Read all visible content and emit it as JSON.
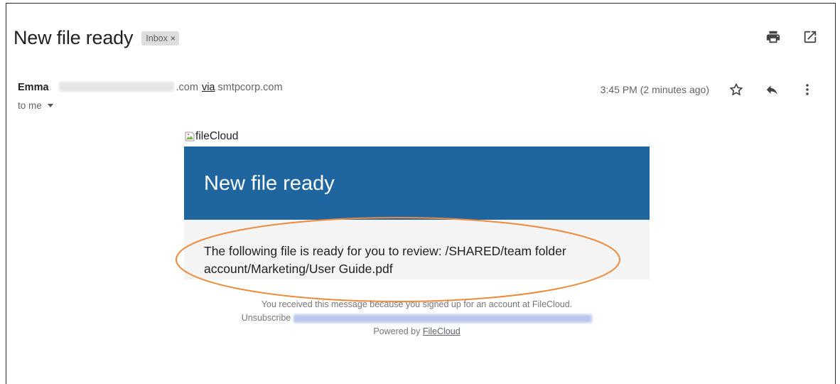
{
  "email": {
    "subject": "New file ready",
    "label": "Inbox",
    "label_remove": "×",
    "sender_name": "Emma",
    "sender_domain": ".com",
    "via_word": "via",
    "via_host": "smtpcorp.com",
    "recipient": "to me",
    "timestamp": "3:45 PM (2 minutes ago)"
  },
  "icons": {
    "print": "printer-icon",
    "open_new": "open-in-new-window-icon",
    "star": "star-icon",
    "reply": "reply-icon",
    "more": "more-vertical-icon",
    "broken_image": "broken-image-icon"
  },
  "message": {
    "logo_alt": "fileCloud",
    "banner_title": "New file ready",
    "body": "The following file is ready for you to review: /SHARED/team folder account/Marketing/User Guide.pdf",
    "footer_notice": "You received this message because you signed up for an account at FileCloud.",
    "unsubscribe": "Unsubscribe",
    "powered_prefix": "Powered by",
    "powered_link": "FileCloud"
  },
  "colors": {
    "banner": "#1f65a0",
    "annotation": "#ef8a3c"
  }
}
